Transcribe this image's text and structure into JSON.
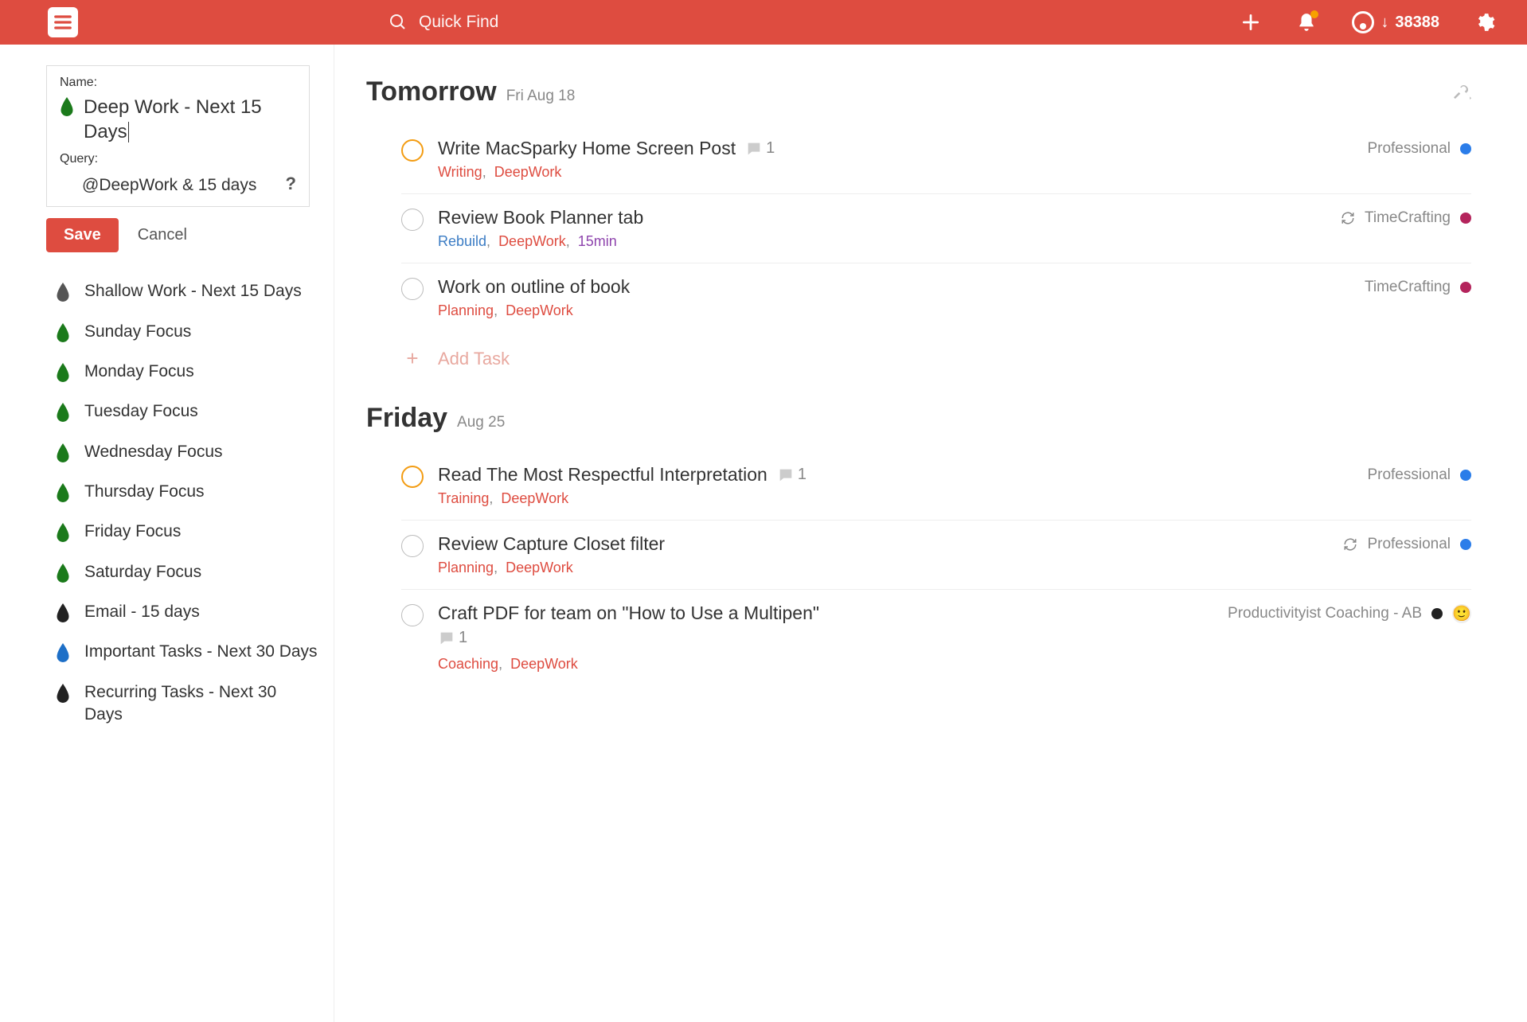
{
  "header": {
    "search_placeholder": "Quick Find",
    "karma_points": "38388"
  },
  "filter_edit": {
    "name_label": "Name:",
    "name_value": "Deep Work - Next 15 Days",
    "query_label": "Query:",
    "query_value": "@DeepWork & 15 days",
    "save": "Save",
    "cancel": "Cancel"
  },
  "filters": [
    {
      "label": "Shallow Work - Next 15 Days",
      "color": "#555"
    },
    {
      "label": "Sunday Focus",
      "color": "#1b7a1b"
    },
    {
      "label": "Monday Focus",
      "color": "#1b7a1b"
    },
    {
      "label": "Tuesday Focus",
      "color": "#1b7a1b"
    },
    {
      "label": "Wednesday Focus",
      "color": "#1b7a1b"
    },
    {
      "label": "Thursday Focus",
      "color": "#1b7a1b"
    },
    {
      "label": "Friday Focus",
      "color": "#1b7a1b"
    },
    {
      "label": "Saturday Focus",
      "color": "#1b7a1b"
    },
    {
      "label": "Email - 15 days",
      "color": "#222"
    },
    {
      "label": "Important Tasks - Next 30 Days",
      "color": "#1d6fc7"
    },
    {
      "label": "Recurring Tasks - Next 30 Days",
      "color": "#222"
    }
  ],
  "sections": [
    {
      "title": "Tomorrow",
      "subtitle": "Fri Aug 18",
      "show_tools": true,
      "tasks": [
        {
          "priority": "p2",
          "title": "Write MacSparky Home Screen Post",
          "comments": "1",
          "project": "Professional",
          "project_color": "#2b7de9",
          "recurring": false,
          "avatar": false,
          "labels": [
            {
              "text": "Writing",
              "cls": "lbl-tag"
            },
            {
              "text": "DeepWork",
              "cls": "lbl-tag"
            }
          ]
        },
        {
          "priority": "",
          "title": "Review Book Planner tab",
          "comments": "",
          "project": "TimeCrafting",
          "project_color": "#b4245c",
          "recurring": true,
          "avatar": false,
          "labels": [
            {
              "text": "Rebuild",
              "cls": "lbl-tag blue"
            },
            {
              "text": "DeepWork",
              "cls": "lbl-tag"
            },
            {
              "text": "15min",
              "cls": "lbl-tag purple"
            }
          ]
        },
        {
          "priority": "",
          "title": "Work on outline of book",
          "comments": "",
          "project": "TimeCrafting",
          "project_color": "#b4245c",
          "recurring": false,
          "avatar": false,
          "labels": [
            {
              "text": "Planning",
              "cls": "lbl-tag"
            },
            {
              "text": "DeepWork",
              "cls": "lbl-tag"
            }
          ]
        }
      ]
    },
    {
      "title": "Friday",
      "subtitle": "Aug 25",
      "show_tools": false,
      "tasks": [
        {
          "priority": "p2",
          "title": "Read The Most Respectful Interpretation",
          "comments": "1",
          "project": "Professional",
          "project_color": "#2b7de9",
          "recurring": false,
          "avatar": false,
          "labels": [
            {
              "text": "Training",
              "cls": "lbl-tag"
            },
            {
              "text": "DeepWork",
              "cls": "lbl-tag"
            }
          ]
        },
        {
          "priority": "",
          "title": "Review Capture Closet filter",
          "comments": "",
          "project": "Professional",
          "project_color": "#2b7de9",
          "recurring": true,
          "avatar": false,
          "labels": [
            {
              "text": "Planning",
              "cls": "lbl-tag"
            },
            {
              "text": "DeepWork",
              "cls": "lbl-tag"
            }
          ]
        },
        {
          "priority": "",
          "title": "Craft PDF for team on \"How to Use a Multipen\"",
          "comments": "1",
          "comments_below": true,
          "project": "Productivityist Coaching - AB",
          "project_color": "#222",
          "recurring": false,
          "avatar": true,
          "labels": [
            {
              "text": "Coaching",
              "cls": "lbl-tag"
            },
            {
              "text": "DeepWork",
              "cls": "lbl-tag"
            }
          ]
        }
      ]
    }
  ],
  "add_task": "Add Task"
}
